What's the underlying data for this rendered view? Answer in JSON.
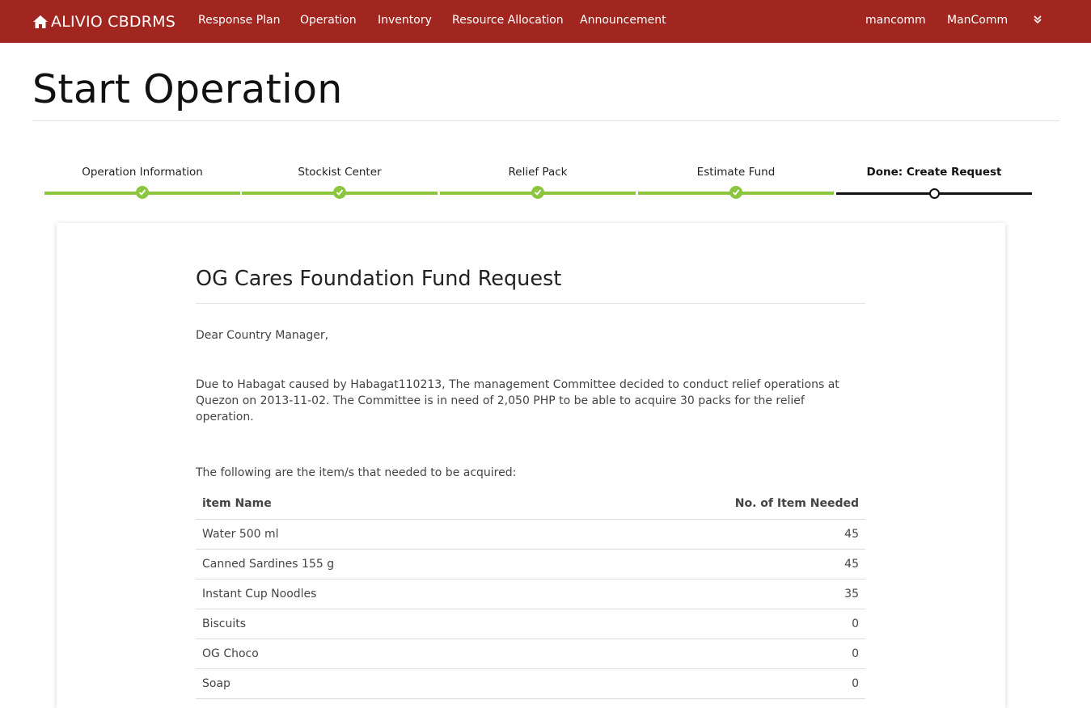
{
  "navbar": {
    "brand": "ALIVIO CBDRMS",
    "items": [
      {
        "label": "Response Plan"
      },
      {
        "label": "Operation"
      },
      {
        "label": "Inventory"
      },
      {
        "label": "Resource Allocation"
      },
      {
        "label": "Announcement"
      }
    ],
    "user_name": "mancomm",
    "user_role": "ManComm",
    "brand_color": "#a0261f"
  },
  "page": {
    "title": "Start Operation"
  },
  "stepper": {
    "steps": [
      {
        "label": "Operation Information",
        "status": "complete"
      },
      {
        "label": "Stockist Center",
        "status": "complete"
      },
      {
        "label": "Relief Pack",
        "status": "complete"
      },
      {
        "label": "Estimate Fund",
        "status": "complete"
      },
      {
        "label": "Done: Create Request",
        "status": "active"
      }
    ],
    "complete_color": "#8cc63f",
    "active_color": "#111111"
  },
  "letter": {
    "title": "OG Cares Foundation Fund Request",
    "salutation": "Dear Country Manager,",
    "body": "Due to Habagat caused by Habagat110213, The management Committee decided to conduct relief operations at Quezon on 2013-11-02. The Committee is in need of 2,050 PHP to be able to acquire 30 packs for the relief operation.",
    "items_intro": "The following are the item/s that needed to be acquired:",
    "table": {
      "headers": [
        "item Name",
        "No. of Item Needed"
      ],
      "rows": [
        {
          "name": "Water 500 ml",
          "qty": "45"
        },
        {
          "name": "Canned Sardines 155 g",
          "qty": "45"
        },
        {
          "name": "Instant Cup Noodles",
          "qty": "35"
        },
        {
          "name": "Biscuits",
          "qty": "0"
        },
        {
          "name": "OG Choco",
          "qty": "0"
        },
        {
          "name": "Soap",
          "qty": "0"
        }
      ]
    }
  }
}
